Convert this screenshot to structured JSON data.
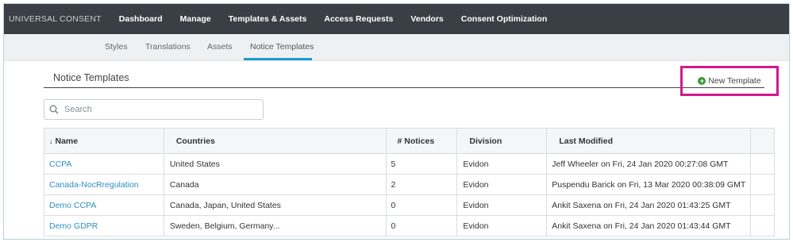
{
  "topnav": {
    "brand": "UNIVERSAL CONSENT",
    "items": [
      "Dashboard",
      "Manage",
      "Templates & Assets",
      "Access Requests",
      "Vendors",
      "Consent Optimization"
    ]
  },
  "subnav": {
    "items": [
      "Styles",
      "Translations",
      "Assets",
      "Notice Templates"
    ],
    "active": "Notice Templates"
  },
  "page": {
    "title": "Notice Templates",
    "new_template_label": "New Template"
  },
  "search": {
    "placeholder": "Search",
    "value": ""
  },
  "table": {
    "sort_icon": "arrow-down",
    "columns": [
      "Name",
      "Countries",
      "# Notices",
      "Division",
      "Last Modified"
    ],
    "rows": [
      {
        "name": "CCPA",
        "countries": "United States",
        "notices": "5",
        "division": "Evidon",
        "modified": "Jeff Wheeler on Fri, 24 Jan 2020 00:27:08 GMT"
      },
      {
        "name": "Canada-NocRregulation",
        "countries": "Canada",
        "notices": "2",
        "division": "Evidon",
        "modified": "Puspendu Barick on Fri, 13 Mar 2020 00:38:09 GMT"
      },
      {
        "name": "Demo CCPA",
        "countries": "Canada, Japan, United States",
        "notices": "0",
        "division": "Evidon",
        "modified": "Ankit Saxena on Fri, 24 Jan 2020 01:43:25 GMT"
      },
      {
        "name": "Demo GDPR",
        "countries": "Sweden, Belgium, Germany...",
        "notices": "0",
        "division": "Evidon",
        "modified": "Ankit Saxena on Fri, 24 Jan 2020 01:43:44 GMT"
      }
    ]
  },
  "colors": {
    "topbar": "#3a3f45",
    "accent": "#1b9bd1",
    "link": "#2c8fc3",
    "highlight": "#d1198c",
    "add_icon": "#3a9a3a"
  }
}
